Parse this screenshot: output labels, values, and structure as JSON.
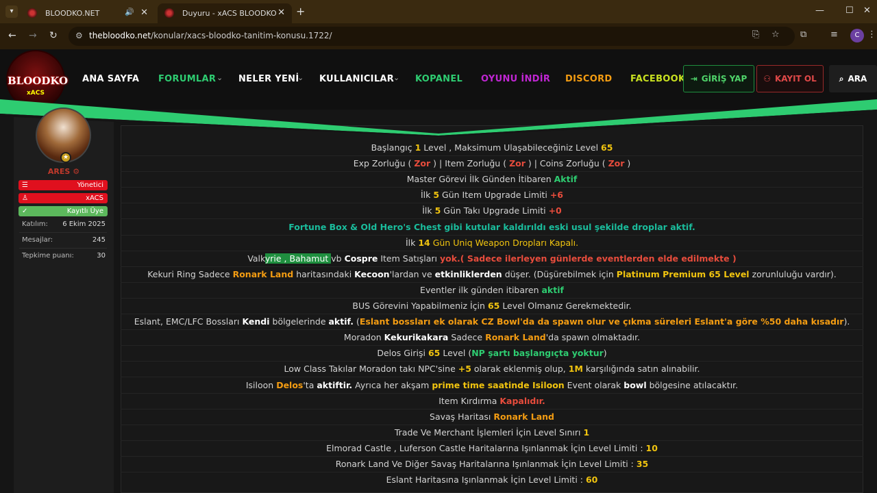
{
  "browser": {
    "tabs": [
      {
        "title": "BLOODKO.NET"
      },
      {
        "title": "Duyuru - xACS BLOODKO TANIT"
      }
    ],
    "url_host": "thebloodko.net",
    "url_path": "/konular/xacs-bloodko-tanitim-konusu.1722/",
    "profile_initial": "C"
  },
  "site": {
    "logo_text": "BLOODKO",
    "logo_sub": "xACS",
    "nav": [
      {
        "label": "ANA SAYFA",
        "color": "#ffffff"
      },
      {
        "label": "FORUMLAR",
        "color": "#2ecc71"
      },
      {
        "label": "NELER YENİ",
        "color": "#ffffff"
      },
      {
        "label": "KULLANICILAR",
        "color": "#ffffff"
      },
      {
        "label": "KOPANEL",
        "color": "#2ecc71"
      },
      {
        "label": "OYUNU İNDİR",
        "color": "#c026d3"
      },
      {
        "label": "DISCORD",
        "color": "#f39c12"
      },
      {
        "label": "FACEBOOK",
        "color": "#c8e020"
      }
    ],
    "login_label": "GİRİŞ YAP",
    "register_label": "KAYIT OL",
    "search_label": "ARA",
    "accent_green": "#2ecc71"
  },
  "user": {
    "name": "ARES",
    "badges": [
      {
        "label": "Yönetici",
        "color": "#e0101e"
      },
      {
        "label": "xACS",
        "color": "#e0101e"
      },
      {
        "label": "Kayıtlı Üye",
        "color": "#5cb85c"
      }
    ],
    "stats": [
      {
        "label": "Katılım:",
        "value": "6 Ekim 2025"
      },
      {
        "label": "Mesajlar:",
        "value": "245"
      },
      {
        "label": "Tepkime puanı:",
        "value": "30"
      }
    ]
  },
  "post": {
    "lines": [
      [
        {
          "t": "Başlangıç "
        },
        {
          "t": "1",
          "c": "y"
        },
        {
          "t": " Level , Maksimum Ulaşabileceğiniz Level "
        },
        {
          "t": "65",
          "c": "y"
        }
      ],
      [
        {
          "t": "Exp Zorluğu ( "
        },
        {
          "t": "Zor",
          "c": "r"
        },
        {
          "t": " ) | Item Zorluğu ( "
        },
        {
          "t": "Zor",
          "c": "r"
        },
        {
          "t": " ) | Coins Zorluğu ( "
        },
        {
          "t": "Zor",
          "c": "r"
        },
        {
          "t": " )"
        }
      ],
      [
        {
          "t": "Master Görevi İlk Günden İtibaren "
        },
        {
          "t": "Aktif",
          "c": "g"
        }
      ],
      [
        {
          "t": "İlk "
        },
        {
          "t": "5",
          "c": "y"
        },
        {
          "t": " Gün Item Upgrade Limiti "
        },
        {
          "t": "+6",
          "c": "r"
        }
      ],
      [
        {
          "t": "İlk "
        },
        {
          "t": "5",
          "c": "y"
        },
        {
          "t": " Gün Takı Upgrade Limiti "
        },
        {
          "t": "+0",
          "c": "r"
        }
      ],
      [
        {
          "t": "Fortune Box & Old Hero's Chest gibi kutular kaldırıldı eski usul şekilde droplar aktif.",
          "c": "c"
        }
      ],
      [
        {
          "t": "İlk "
        },
        {
          "t": "14",
          "c": "y"
        },
        {
          "t": " Gün Uniq Weapon Dropları Kapalı.",
          "c": "y2"
        }
      ],
      [
        {
          "t": "Valk"
        },
        {
          "t": "yrie , Bahamut ",
          "c": "hl"
        },
        {
          "t": "vb "
        },
        {
          "t": "Cospre",
          "c": "w"
        },
        {
          "t": " Item Satışları "
        },
        {
          "t": "yok.( Sadece ilerleyen günlerde eventlerden elde edilmekte )",
          "c": "r"
        }
      ],
      [
        {
          "t": "Kekuri Ring Sadece "
        },
        {
          "t": "Ronark Land",
          "c": "o"
        },
        {
          "t": " haritasındaki "
        },
        {
          "t": "Kecoon",
          "c": "w"
        },
        {
          "t": "'lardan ve "
        },
        {
          "t": "etkinliklerden",
          "c": "w"
        },
        {
          "t": " düşer. (Düşürebilmek için "
        },
        {
          "t": "Platinum Premium 65 Level",
          "c": "y"
        },
        {
          "t": " zorunluluğu vardır)."
        }
      ],
      [
        {
          "t": "Eventler ilk günden itibaren "
        },
        {
          "t": "aktif",
          "c": "g"
        }
      ],
      [
        {
          "t": "BUS Görevini Yapabilmeniz İçin "
        },
        {
          "t": "65",
          "c": "y"
        },
        {
          "t": " Level Olmanız Gerekmektedir."
        }
      ],
      [
        {
          "t": "Eslant, EMC/LFC Bossları "
        },
        {
          "t": "Kendi",
          "c": "w"
        },
        {
          "t": " bölgelerinde "
        },
        {
          "t": "aktif.",
          "c": "w"
        },
        {
          "t": " ("
        },
        {
          "t": "Eslant bossları ek olarak CZ Bowl'da da spawn olur ve çıkma süreleri Eslant'a göre %50 daha kısadır",
          "c": "o"
        },
        {
          "t": ")."
        }
      ],
      [
        {
          "t": "Moradon "
        },
        {
          "t": "Kekurikakara",
          "c": "w"
        },
        {
          "t": " Sadece "
        },
        {
          "t": "Ronark Land",
          "c": "o"
        },
        {
          "t": "'da spawn olmaktadır."
        }
      ],
      [
        {
          "t": "Delos Girişi "
        },
        {
          "t": "65",
          "c": "y"
        },
        {
          "t": " Level ("
        },
        {
          "t": "NP şartı başlangıçta yoktur",
          "c": "g"
        },
        {
          "t": ")"
        }
      ],
      [
        {
          "t": "Low Class Takılar Moradon takı NPC'sine "
        },
        {
          "t": "+5",
          "c": "y"
        },
        {
          "t": " olarak eklenmiş olup, "
        },
        {
          "t": "1M",
          "c": "y"
        },
        {
          "t": " karşılığında satın alınabilir."
        }
      ],
      [
        {
          "t": "Isiloon "
        },
        {
          "t": "Delos",
          "c": "o"
        },
        {
          "t": "'ta "
        },
        {
          "t": "aktiftir.",
          "c": "w"
        },
        {
          "t": " Ayrıca her akşam "
        },
        {
          "t": "prime time saatinde Isiloon",
          "c": "y"
        },
        {
          "t": " Event olarak "
        },
        {
          "t": "bowl",
          "c": "w"
        },
        {
          "t": " bölgesine atılacaktır."
        }
      ],
      [
        {
          "t": "Item Kırdırma "
        },
        {
          "t": "Kapalıdır.",
          "c": "r"
        }
      ],
      [
        {
          "t": "Savaş Haritası "
        },
        {
          "t": "Ronark Land",
          "c": "o"
        }
      ],
      [
        {
          "t": "Trade Ve Merchant İşlemleri İçin Level Sınırı "
        },
        {
          "t": "1",
          "c": "y"
        }
      ],
      [
        {
          "t": "Elmorad Castle , Luferson Castle Haritalarına Işınlanmak İçin Level Limiti : "
        },
        {
          "t": "10",
          "c": "y"
        }
      ],
      [
        {
          "t": "Ronark Land Ve Diğer Savaş Haritalarına Işınlanmak İçin Level Limiti : "
        },
        {
          "t": "35",
          "c": "y"
        }
      ],
      [
        {
          "t": "Eslant Haritasına Işınlanmak İçin Level Limiti : "
        },
        {
          "t": "60",
          "c": "y"
        }
      ]
    ]
  }
}
